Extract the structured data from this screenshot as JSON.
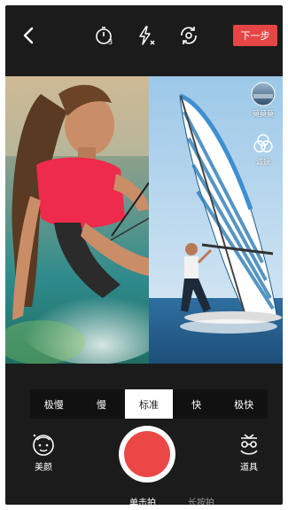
{
  "topbar": {
    "back_icon": "chevron-left-icon",
    "timer_icon": "timer-icon",
    "flash_icon": "flash-off-icon",
    "flip_icon": "camera-flip-icon",
    "next_label": "下一步"
  },
  "side_tools": {
    "items": [
      {
        "label": "莫莫莫",
        "icon": "music-thumbnail-icon"
      },
      {
        "label": "滤镜",
        "icon": "filter-icon"
      }
    ]
  },
  "speed": {
    "options": [
      "极慢",
      "慢",
      "标准",
      "快",
      "极快"
    ],
    "selected": "标准"
  },
  "bottom": {
    "beauty_label": "美颜",
    "props_label": "道具",
    "modes": {
      "tap": "单击拍",
      "hold": "长按拍",
      "selected": "单击拍"
    }
  },
  "colors": {
    "accent": "#e64545",
    "background": "#1b1b1b",
    "shutter_red": "#ec4747"
  }
}
